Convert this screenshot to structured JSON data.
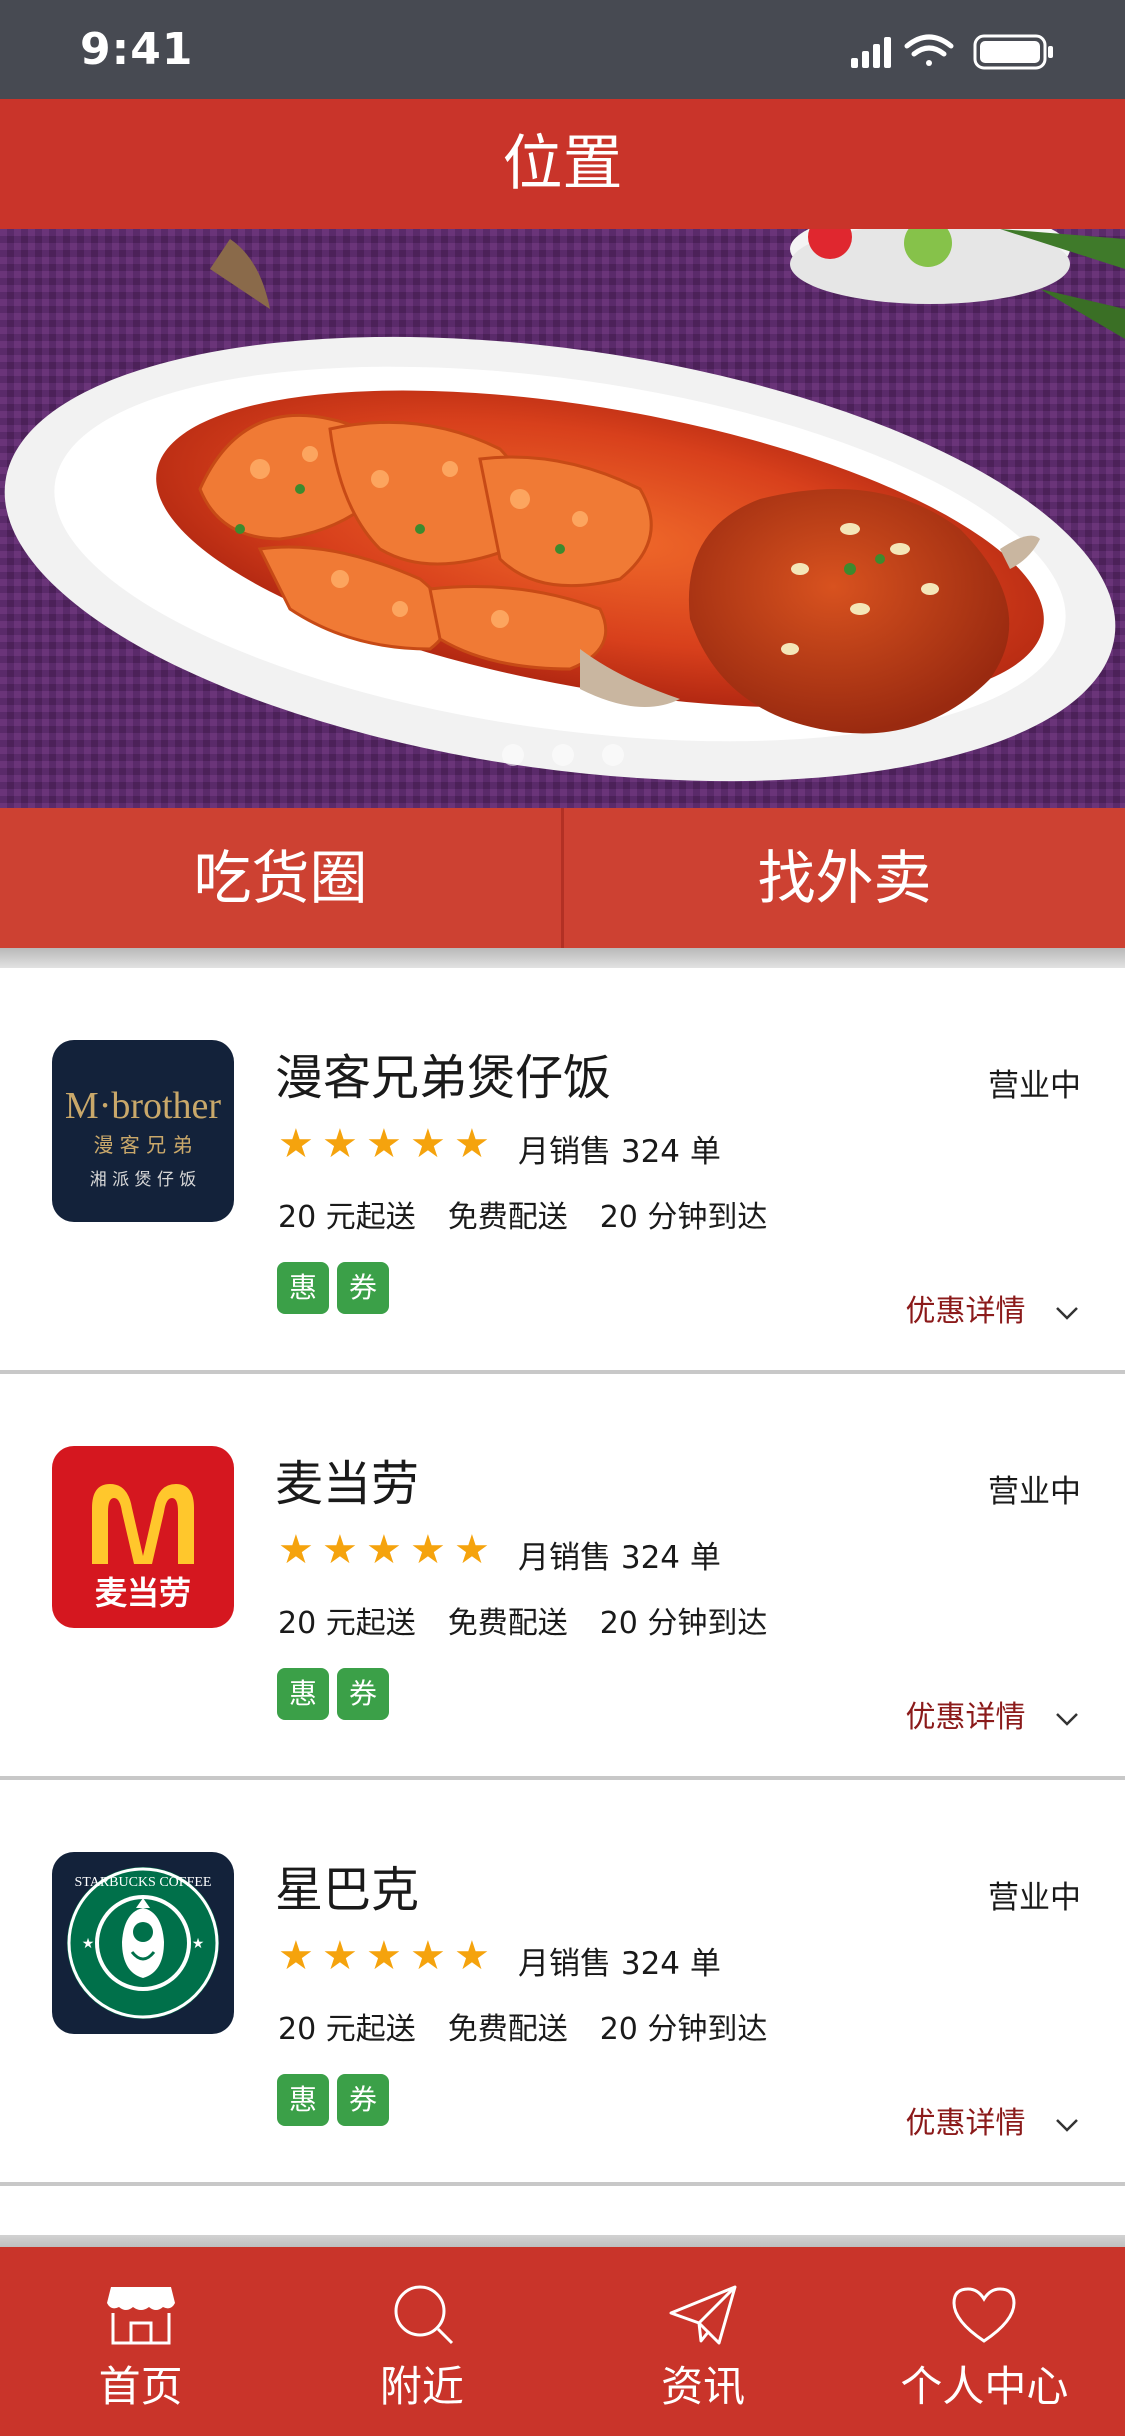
{
  "status_bar": {
    "time": "9:41"
  },
  "header": {
    "title": "位置"
  },
  "banner": {
    "image": "braised-fish-dish",
    "dots": 3
  },
  "actions": {
    "left": "吃货圈",
    "right": "找外卖"
  },
  "restaurants": [
    {
      "name": "漫客兄弟煲仔饭",
      "status": "营业中",
      "rating": 5,
      "sales": "月销售 324 单",
      "min_order": "20 元起送",
      "delivery": "免费配送",
      "time": "20 分钟到达",
      "badges": [
        "惠",
        "券"
      ],
      "promo": "优惠详情",
      "logo": {
        "icon": "mbrother-logo",
        "brand": "M·brother",
        "sub": "漫 客 兄 弟",
        "tagline": "湘 派 煲 仔 饭"
      }
    },
    {
      "name": "麦当劳",
      "status": "营业中",
      "rating": 5,
      "sales": "月销售 324 单",
      "min_order": "20 元起送",
      "delivery": "免费配送",
      "time": "20 分钟到达",
      "badges": [
        "惠",
        "券"
      ],
      "promo": "优惠详情",
      "logo": {
        "icon": "mcdonalds-logo",
        "brand": "麦当劳"
      }
    },
    {
      "name": "星巴克",
      "status": "营业中",
      "rating": 5,
      "sales": "月销售 324 单",
      "min_order": "20 元起送",
      "delivery": "免费配送",
      "time": "20 分钟到达",
      "badges": [
        "惠",
        "券"
      ],
      "promo": "优惠详情",
      "logo": {
        "icon": "starbucks-logo",
        "brand": "STARBUCKS COFFEE"
      }
    }
  ],
  "tabbar": [
    {
      "label": "首页",
      "icon": "store-icon"
    },
    {
      "label": "附近",
      "icon": "search-icon"
    },
    {
      "label": "资讯",
      "icon": "paper-plane-icon"
    },
    {
      "label": "个人中心",
      "icon": "heart-icon"
    }
  ],
  "colors": {
    "primary": "#c9342a",
    "status_bar": "#474a52",
    "badge": "#3ba048",
    "star": "#f5a30d",
    "promo": "#8b1a1a"
  }
}
